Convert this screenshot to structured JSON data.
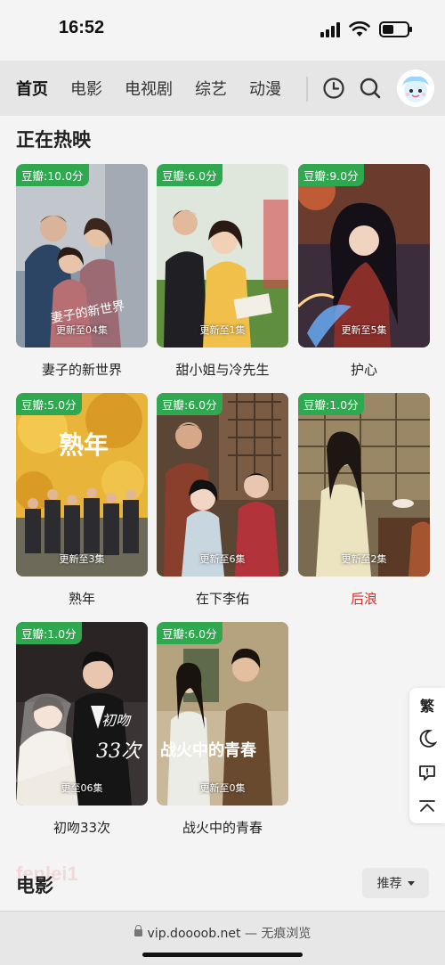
{
  "status_bar": {
    "time": "16:52",
    "icons": [
      "signal-icon",
      "wifi-icon",
      "battery-icon"
    ],
    "battery_level": 0.45
  },
  "nav": {
    "tabs": [
      {
        "label": "首页",
        "active": true
      },
      {
        "label": "电影",
        "active": false
      },
      {
        "label": "电视剧",
        "active": false
      },
      {
        "label": "综艺",
        "active": false
      },
      {
        "label": "动漫",
        "active": false
      }
    ],
    "icons": [
      "history-clock-icon",
      "search-icon",
      "avatar-icon"
    ],
    "accent_color": "#f5c531"
  },
  "now_showing": {
    "title": "正在热映",
    "items": [
      {
        "score": "豆瓣:10.0分",
        "update": "更新至04集",
        "title": "妻子的新世界",
        "highlight": false
      },
      {
        "score": "豆瓣:6.0分",
        "update": "更新至1集",
        "title": "甜小姐与冷先生",
        "highlight": false
      },
      {
        "score": "豆瓣:9.0分",
        "update": "更新至5集",
        "title": "护心",
        "highlight": false
      },
      {
        "score": "豆瓣:5.0分",
        "update": "更新至3集",
        "title": "熟年",
        "highlight": false
      },
      {
        "score": "豆瓣:6.0分",
        "update": "更新至6集",
        "title": "在下李佑",
        "highlight": false
      },
      {
        "score": "豆瓣:1.0分",
        "update": "更新至2集",
        "title": "后浪",
        "highlight": true
      },
      {
        "score": "豆瓣:1.0分",
        "update": "更至06集",
        "title": "初吻33次",
        "highlight": false
      },
      {
        "score": "豆瓣:6.0分",
        "update": "更新至0集",
        "title": "战火中的青春",
        "highlight": false
      }
    ],
    "poster_text": {
      "shunian": "熟年",
      "chuwen": "初吻",
      "chuwen_num": "33次",
      "zhanhuo": "战火中的青春",
      "wife": "妻子的新世界"
    },
    "badge_color": "#2fa84f",
    "highlight_color": "#d0322b"
  },
  "side_toolbar": {
    "traditional_label": "繁",
    "icons": [
      "dark-mode-moon-icon",
      "feedback-icon",
      "back-to-top-icon"
    ]
  },
  "movies": {
    "title": "电影",
    "sort_label": "推荐",
    "watermark": "fenlei1"
  },
  "url_bar": {
    "host": "vip.doooob.net",
    "suffix": " — 无痕浏览"
  }
}
